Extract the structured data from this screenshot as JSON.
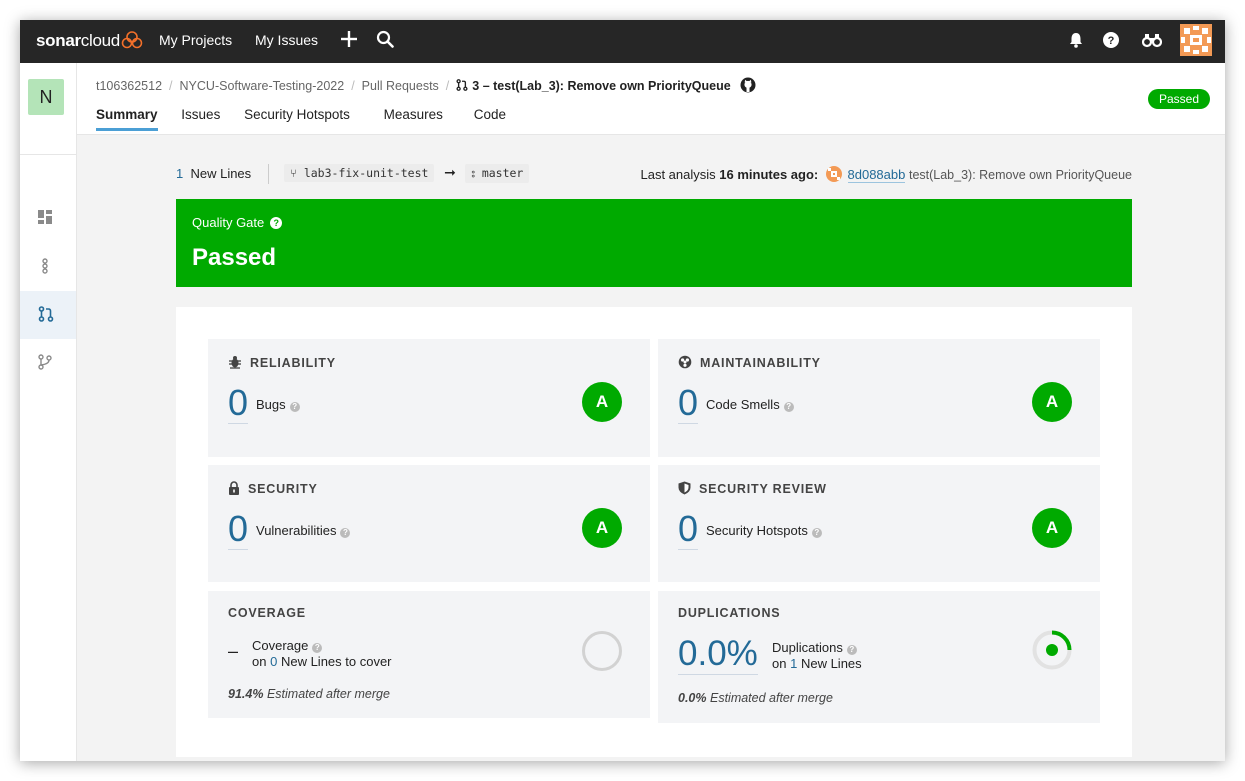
{
  "topbar": {
    "logo_main": "sonar",
    "logo_rest": "cloud",
    "nav": [
      "My Projects",
      "My Issues"
    ],
    "icons": [
      "plus-icon",
      "search-icon",
      "bell-icon",
      "help-icon",
      "binoculars-icon",
      "user-avatar"
    ]
  },
  "sidebar": {
    "project_initial": "N",
    "items": [
      "dashboard-icon",
      "branch-chain-icon",
      "pull-request-icon",
      "branch-icon"
    ],
    "active_index": 2
  },
  "breadcrumb": {
    "organization": "t106362512",
    "project": "NYCU-Software-Testing-2022",
    "section": "Pull Requests",
    "pull_request": "3 – test(Lab_3): Remove own PriorityQueue"
  },
  "tabs": [
    "Summary",
    "Issues",
    "Security Hotspots",
    "Measures",
    "Code"
  ],
  "active_tab": "Summary",
  "status_badge": "Passed",
  "info": {
    "new_lines_count": "1",
    "new_lines_label": "New Lines",
    "source_branch": "lab3-fix-unit-test",
    "target_branch": "master",
    "last_analysis_label": "Last analysis",
    "last_analysis_time": "16 minutes ago:",
    "commit_hash": "8d088abb",
    "commit_message": "test(Lab_3): Remove own PriorityQueue"
  },
  "quality_gate": {
    "label": "Quality Gate",
    "help": "?",
    "status": "Passed"
  },
  "measures": {
    "reliability": {
      "title": "RELIABILITY",
      "value": "0",
      "label": "Bugs",
      "rating": "A"
    },
    "maintainability": {
      "title": "MAINTAINABILITY",
      "value": "0",
      "label": "Code Smells",
      "rating": "A"
    },
    "security": {
      "title": "SECURITY",
      "value": "0",
      "label": "Vulnerabilities",
      "rating": "A"
    },
    "security_review": {
      "title": "SECURITY REVIEW",
      "value": "0",
      "label": "Security Hotspots",
      "rating": "A"
    },
    "coverage": {
      "title": "COVERAGE",
      "value": "–",
      "label": "Coverage",
      "on": "on",
      "lines_count": "0",
      "lines_label": "New Lines to cover",
      "estimated_value": "91.4%",
      "estimated_label": "Estimated after merge"
    },
    "duplications": {
      "title": "DUPLICATIONS",
      "value": "0.0%",
      "label": "Duplications",
      "on": "on",
      "lines_count": "1",
      "lines_label": "New Lines",
      "estimated_value": "0.0%",
      "estimated_label": "Estimated after merge"
    }
  },
  "colors": {
    "topbar_bg": "#262626",
    "passed_green": "#00aa00",
    "link_blue": "#236a97",
    "card_bg": "#f3f4f6"
  }
}
